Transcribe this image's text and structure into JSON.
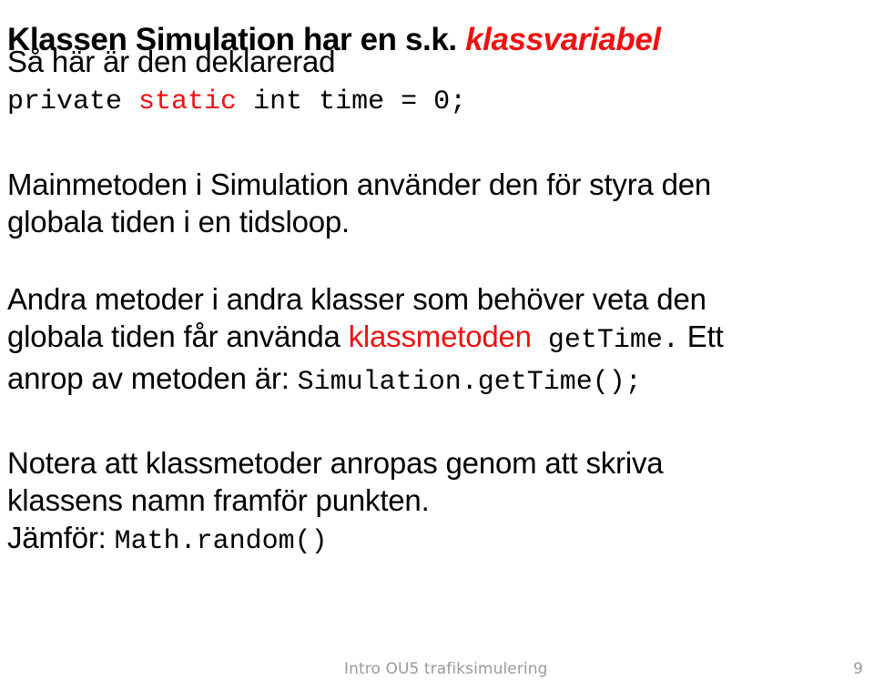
{
  "slide": {
    "title": {
      "lead": "Klassen Simulation har en s.k. ",
      "accent": "klassvariabel",
      "accent_color": "#ee1111"
    },
    "blocks": {
      "declare": {
        "line1": "Så här är den deklarerad"
      },
      "code": {
        "part1": "private ",
        "keyword": "static",
        "part2": " int time = 0;"
      },
      "main": {
        "line1": "Mainmetoden i Simulation använder den för styra den",
        "line2": "globala tiden i en tidsloop."
      },
      "methods": {
        "line1": "Andra metoder i andra klasser som behöver veta den",
        "line2_a": "globala tiden får använda ",
        "line2_red": "klassmetoden",
        "line2_code": " getTime.",
        "line2_b": " Ett",
        "line3_a": "anrop av metoden är: ",
        "line3_code": "Simulation.getTime();"
      },
      "note": {
        "line1": "Notera att klassmetoder anropas genom att skriva",
        "line2": "klassens namn framför punkten.",
        "line3_a": "Jämför: ",
        "line3_code": "Math.random()"
      }
    },
    "footer": {
      "text": "Intro OU5 trafiksimulering",
      "page": "9",
      "color": "#9a9a9a"
    }
  }
}
